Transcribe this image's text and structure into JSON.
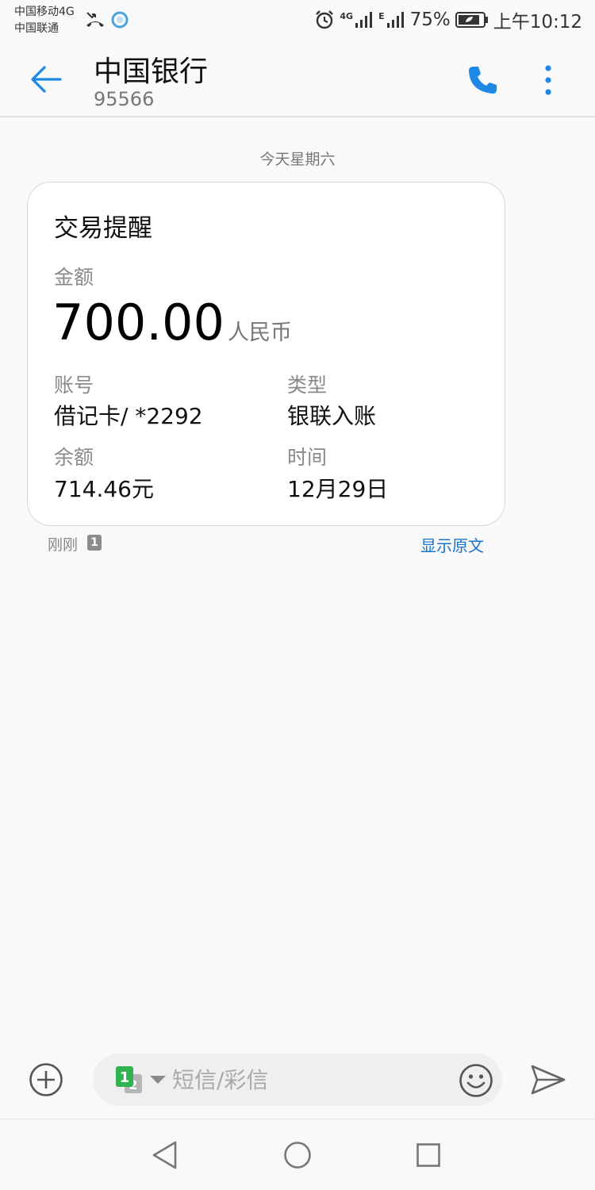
{
  "status_bar": {
    "carrier1": "中国移动4G",
    "carrier2": "中国联通",
    "network1": "4G",
    "network2": "E",
    "battery": "75%",
    "time": "上午10:12"
  },
  "header": {
    "contact_name": "中国银行",
    "contact_number": "95566"
  },
  "conversation": {
    "date_divider": "今天星期六",
    "message": {
      "title": "交易提醒",
      "amount_label": "金额",
      "amount": "700.00",
      "currency": "人民币",
      "fields": [
        {
          "label": "账号",
          "value": "借记卡/ *2292"
        },
        {
          "label": "类型",
          "value": "银联入账"
        },
        {
          "label": "余额",
          "value": "714.46元"
        },
        {
          "label": "时间",
          "value": "12月29日"
        }
      ],
      "sent_time": "刚刚",
      "sim_badge": "1",
      "show_original": "显示原文"
    }
  },
  "composer": {
    "placeholder": "短信/彩信",
    "sim_primary": "1",
    "sim_secondary": "2"
  },
  "colors": {
    "accent": "#1a73c8",
    "icon_blue": "#1e88e5",
    "sim_green": "#2fb24f"
  },
  "icons": [
    "missed-call-icon",
    "app-notification-icon",
    "alarm-icon",
    "signal-icon",
    "battery-icon",
    "back-arrow-icon",
    "phone-icon",
    "more-vertical-icon",
    "plus-circle-icon",
    "sim-card-icon",
    "dropdown-arrow-icon",
    "emoji-icon",
    "send-icon",
    "nav-back-icon",
    "nav-home-icon",
    "nav-recents-icon"
  ]
}
